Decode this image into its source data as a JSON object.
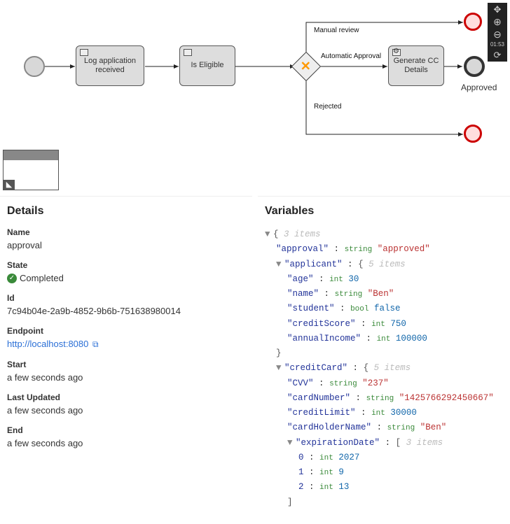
{
  "diagram": {
    "nodes": {
      "log_app": "Log application received",
      "eligible": "Is Eligible",
      "gen_cc": "Generate CC Details"
    },
    "edgeLabels": {
      "manual": "Manual review",
      "auto": "Automatic Approval",
      "rejected": "Rejected"
    },
    "endLabel": "Approved"
  },
  "details": {
    "heading": "Details",
    "nameLabel": "Name",
    "name": "approval",
    "stateLabel": "State",
    "state": "Completed",
    "idLabel": "Id",
    "id": "7c94b04e-2a9b-4852-9b6b-751638980014",
    "endpointLabel": "Endpoint",
    "endpoint": "http://localhost:8080",
    "startLabel": "Start",
    "start": "a few seconds ago",
    "lastUpdatedLabel": "Last Updated",
    "lastUpdated": "a few seconds ago",
    "endLabel": "End",
    "end": "a few seconds ago"
  },
  "variables": {
    "heading": "Variables",
    "rootMeta": "3 items",
    "approvalKey": "approval",
    "approvalType": "string",
    "approvalVal": "\"approved\"",
    "applicantKey": "applicant",
    "applicantMeta": "5 items",
    "applicant": {
      "ageKey": "age",
      "ageType": "int",
      "ageVal": "30",
      "nameKey": "name",
      "nameType": "string",
      "nameVal": "\"Ben\"",
      "studentKey": "student",
      "studentType": "bool",
      "studentVal": "false",
      "creditScoreKey": "creditScore",
      "creditScoreType": "int",
      "creditScoreVal": "750",
      "annualIncomeKey": "annualIncome",
      "annualIncomeType": "int",
      "annualIncomeVal": "100000"
    },
    "ccKey": "creditCard",
    "ccMeta": "5 items",
    "cc": {
      "cvvKey": "CVV",
      "cvvType": "string",
      "cvvVal": "\"237\"",
      "cardNumberKey": "cardNumber",
      "cardNumberType": "string",
      "cardNumberVal": "\"1425766292450667\"",
      "creditLimitKey": "creditLimit",
      "creditLimitType": "int",
      "creditLimitVal": "30000",
      "cardHolderKey": "cardHolderName",
      "cardHolderType": "string",
      "cardHolderVal": "\"Ben\"",
      "expKey": "expirationDate",
      "expMeta": "3 items",
      "exp0Key": "0",
      "exp0Type": "int",
      "exp0Val": "2027",
      "exp1Key": "1",
      "exp1Type": "int",
      "exp1Val": "9",
      "exp2Key": "2",
      "exp2Type": "int",
      "exp2Val": "13"
    }
  }
}
